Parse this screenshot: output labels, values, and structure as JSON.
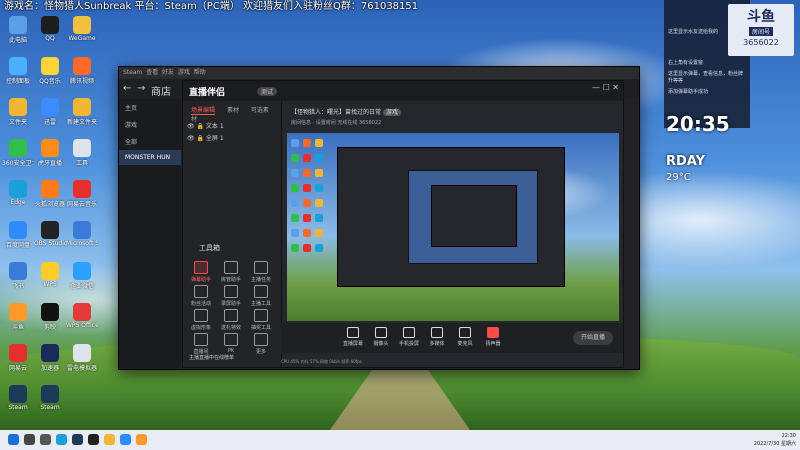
{
  "banner": {
    "text": "游戏名：怪物猎人Sunbreak  平台：Steam（PC端）  欢迎猎友们入驻粉丝Q群：761038151"
  },
  "desktop": {
    "icons": [
      {
        "label": "此电脑",
        "color": "#5aa0e8"
      },
      {
        "label": "QQ",
        "color": "#1d1d1d"
      },
      {
        "label": "WeGame",
        "color": "#f0c040"
      },
      {
        "label": "控制面板",
        "color": "#4ab0ff"
      },
      {
        "label": "QQ音乐",
        "color": "#ffd33a"
      },
      {
        "label": "腾讯视频",
        "color": "#ff6a2a"
      },
      {
        "label": "文件夹",
        "color": "#f2b636"
      },
      {
        "label": "迅雷",
        "color": "#3a8cff"
      },
      {
        "label": "新建文件夹",
        "color": "#f2b636"
      },
      {
        "label": "360安全卫士",
        "color": "#2fbf4a"
      },
      {
        "label": "虎牙直播",
        "color": "#ff8c1a"
      },
      {
        "label": "工具",
        "color": "#dfe4ea"
      },
      {
        "label": "Edge",
        "color": "#1aa0d8"
      },
      {
        "label": "火狐浏览器",
        "color": "#ff7a1a"
      },
      {
        "label": "网易云音乐",
        "color": "#e52e2e"
      },
      {
        "label": "百度网盘",
        "color": "#2f8cff"
      },
      {
        "label": "OBS Studio",
        "color": "#222"
      },
      {
        "label": "Microsoft Store",
        "color": "#3a7ad8"
      },
      {
        "label": "飞书",
        "color": "#3a7ad8"
      },
      {
        "label": "WPS",
        "color": "#ffcc2a"
      },
      {
        "label": "企业微信",
        "color": "#2aa0ff"
      },
      {
        "label": "斗鱼",
        "color": "#ff9a2a"
      },
      {
        "label": "剪映",
        "color": "#111"
      },
      {
        "label": "WPS Office",
        "color": "#e43a3a"
      },
      {
        "label": "网易云",
        "color": "#e52e2e"
      },
      {
        "label": "加速器",
        "color": "#1a2a5a"
      },
      {
        "label": "雷电模拟器",
        "color": "#dfe4ea"
      },
      {
        "label": "Steam",
        "color": "#1e3a5a"
      },
      {
        "label": "Steam",
        "color": "#1e3a5a"
      }
    ]
  },
  "window": {
    "title_items": [
      "Steam",
      "查看",
      "好友",
      "游戏",
      "帮助"
    ],
    "store_label": "商店",
    "side_items": [
      "主页",
      "游戏",
      "全部",
      "MONSTER HUN"
    ],
    "controls": "— ☐ ✕"
  },
  "obs": {
    "logo": "直播伴侣",
    "badge": "测试",
    "tabs": [
      "场景编辑",
      "素材",
      "可选素材"
    ],
    "scenes": [
      "文本 1",
      "全屏 1"
    ],
    "info": "【怪物猎人：曙光】曾找过的日常",
    "info_badge": "游戏",
    "info2": "房间信息 · 设置房间  无线在线  3656022",
    "tools_title": "工具箱",
    "tools": [
      "弹幕助手",
      "房管助手",
      "主播任务",
      "粉丝活动",
      "录屏助手",
      "主播工具",
      "虚拟形象",
      "送礼特效",
      "抽奖工具",
      "直播间",
      "PK",
      "更多"
    ],
    "bottom": [
      "直播屏幕",
      "摄像头",
      "手机投屏",
      "多媒体",
      "麦克风",
      "扬声器"
    ],
    "start_label": "开始直播",
    "notice": "主播直播中在线榜单",
    "status": "CPU 45%  内存 57%  网络 0kb/s  帧率 60fps"
  },
  "room": {
    "logo": "斗鱼",
    "label": "房间号",
    "number": "3656022"
  },
  "side_panel": {
    "rows": [
      "这里显示水友送给我的",
      "右上角有设置窗",
      "这里显示弹幕，查看信息，粉丝牌升等等",
      "添加弹幕助手成功"
    ]
  },
  "weather": {
    "time": "20:35",
    "day": "RDAY",
    "temp": "29°C"
  },
  "tray": {
    "time": "22:30",
    "date": "2022/7/30 星期六"
  },
  "taskbar": {
    "icons": [
      "start-icon",
      "search-icon",
      "taskview-icon",
      "edge-icon",
      "steam-icon",
      "obs-icon",
      "folder-icon",
      "qq-icon",
      "douyu-icon"
    ]
  }
}
